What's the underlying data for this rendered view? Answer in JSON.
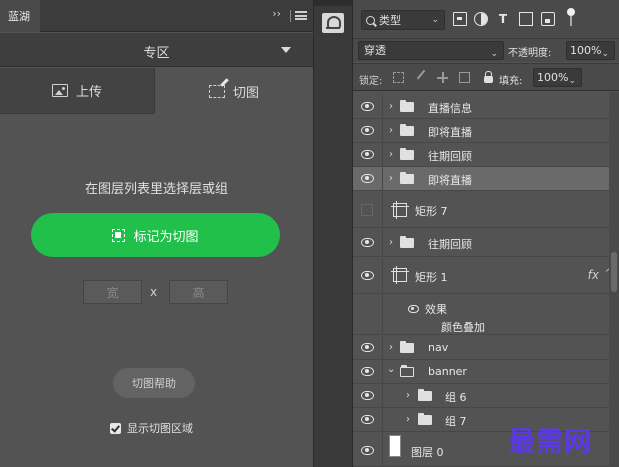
{
  "left_panel": {
    "tab_title": "蓝湖",
    "collapse_glyph": "››",
    "zone_label": "专区",
    "tabs": [
      {
        "label": "上传",
        "icon": "image-icon"
      },
      {
        "label": "切图",
        "icon": "slice-icon"
      }
    ],
    "hint": "在图层列表里选择层或组",
    "mark_button": "标记为切图",
    "width_placeholder": "宽",
    "times": "x",
    "height_placeholder": "高",
    "help_button": "切图帮助",
    "show_area_label": "显示切图区域",
    "show_area_checked": true,
    "accent_color": "#20c04a"
  },
  "layers_panel": {
    "filter_label": "类型",
    "blend_mode": "穿透",
    "opacity_label": "不透明度:",
    "opacity_value": "100%",
    "lock_label": "锁定:",
    "fill_label": "填充:",
    "fill_value": "100%",
    "layers": [
      {
        "name": "直播信息",
        "type": "group"
      },
      {
        "name": "即将直播",
        "type": "group"
      },
      {
        "name": "往期回顾",
        "type": "group"
      },
      {
        "name": "即将直播",
        "type": "group",
        "selected": true
      },
      {
        "name": "矩形 7",
        "type": "shape",
        "hidden": true
      },
      {
        "name": "往期回顾",
        "type": "group"
      },
      {
        "name": "矩形 1",
        "type": "shape",
        "fx": "fx"
      },
      {
        "name": "nav",
        "type": "group"
      },
      {
        "name": "banner",
        "type": "group",
        "expanded": true
      },
      {
        "name": "组 6",
        "type": "group",
        "indent": 1
      },
      {
        "name": "组 7",
        "type": "group",
        "indent": 1
      },
      {
        "name": "图层 0",
        "type": "pixel"
      }
    ],
    "effects_label": "效果",
    "color_overlay_label": "颜色叠加"
  },
  "watermark": "最需网"
}
